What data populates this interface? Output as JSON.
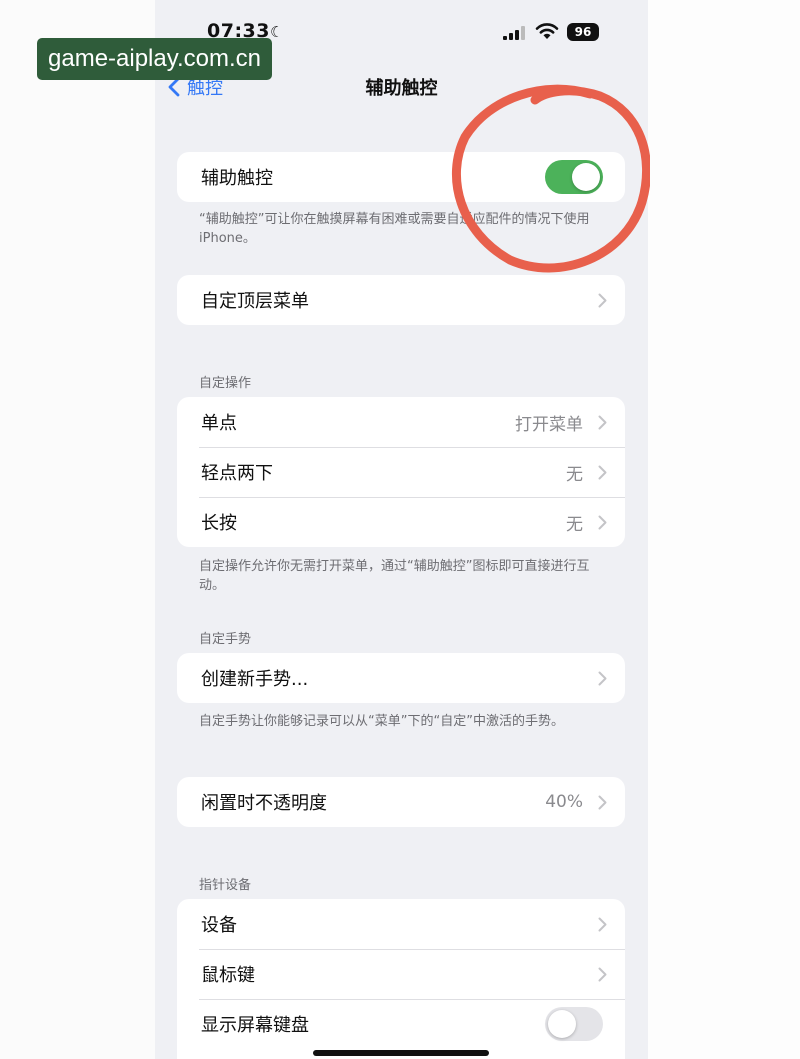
{
  "status_bar": {
    "time": "07:33",
    "battery": "96"
  },
  "watermark": "game-aiplay.com.cn",
  "nav": {
    "back_label": "触控",
    "title": "辅助触控"
  },
  "assistive_touch": {
    "label": "辅助触控",
    "enabled": true,
    "footer": "“辅助触控”可让你在触摸屏幕有困难或需要自适应配件的情况下使用iPhone。"
  },
  "customize_menu": {
    "label": "自定顶层菜单"
  },
  "custom_actions": {
    "header": "自定操作",
    "rows": [
      {
        "label": "单点",
        "value": "打开菜单"
      },
      {
        "label": "轻点两下",
        "value": "无"
      },
      {
        "label": "长按",
        "value": "无"
      }
    ],
    "footer": "自定操作允许你无需打开菜单，通过“辅助触控”图标即可直接进行互动。"
  },
  "custom_gestures": {
    "header": "自定手势",
    "create_label": "创建新手势...",
    "footer": "自定手势让你能够记录可以从“菜单”下的“自定”中激活的手势。"
  },
  "idle_opacity": {
    "label": "闲置时不透明度",
    "value": "40%"
  },
  "pointer_devices": {
    "header": "指针设备",
    "devices_label": "设备",
    "mouse_keys_label": "鼠标键",
    "show_keyboard_label": "显示屏幕键盘",
    "show_keyboard_enabled": false
  },
  "colors": {
    "accent": "#3478f6",
    "toggle_on": "#4cb25a",
    "annotation_circle": "#e8604c",
    "background": "#eff0f4"
  }
}
